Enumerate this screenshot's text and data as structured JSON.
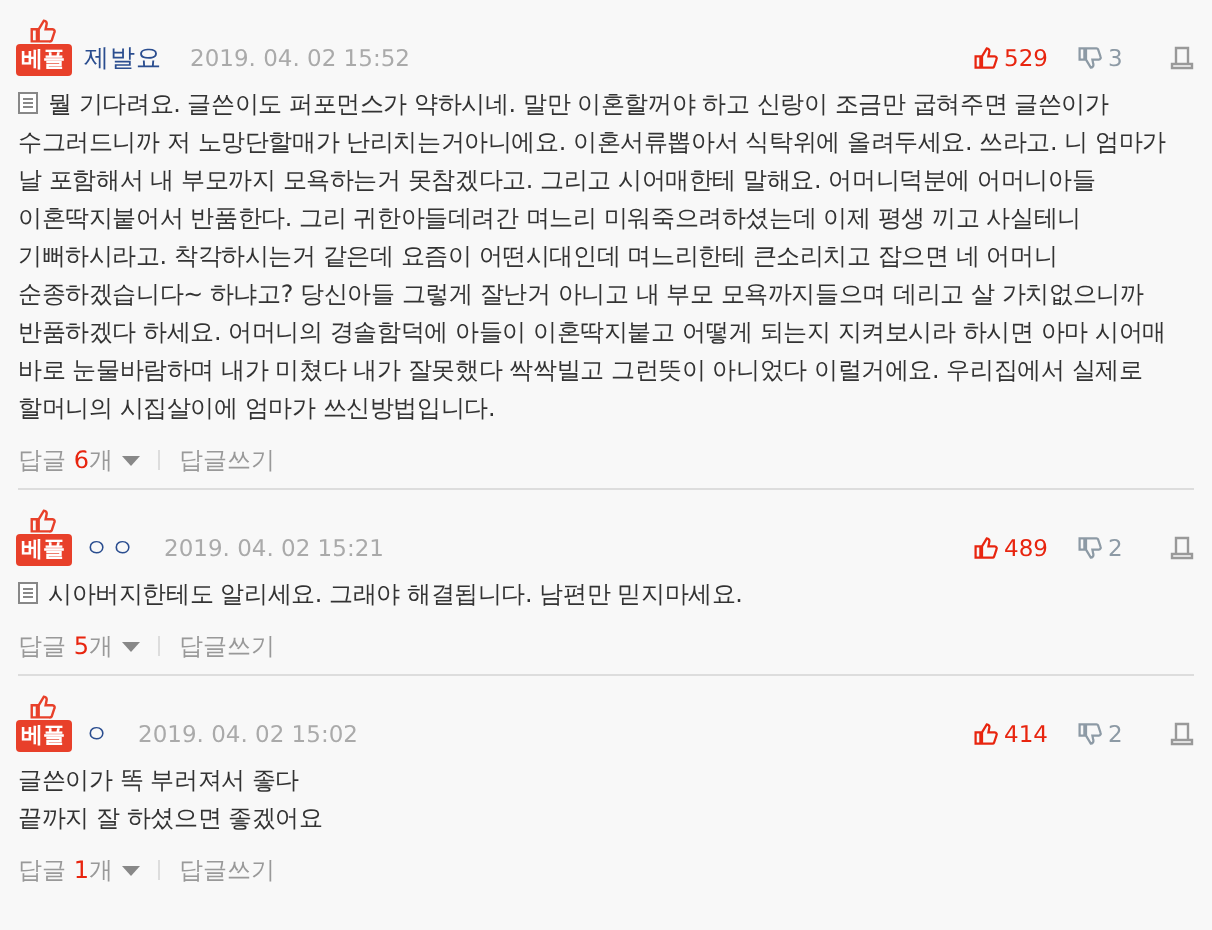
{
  "comments": [
    {
      "badge": "베플",
      "author": "제발요",
      "date": "2019. 04. 02 15:52",
      "likes": "529",
      "dislikes": "3",
      "memo": true,
      "text": "뭘 기다려요. 글쓴이도 퍼포먼스가 약하시네. 말만 이혼할꺼야 하고 신랑이 조금만 굽혀주면 글쓴이가 수그러드니까 저 노망단할매가 난리치는거아니에요. 이혼서류뽑아서 식탁위에 올려두세요. 쓰라고. 니 엄마가 날 포함해서 내 부모까지 모욕하는거 못참겠다고. 그리고 시어매한테 말해요. 어머니덕분에 어머니아들 이혼딱지붙어서 반품한다. 그리 귀한아들데려간 며느리 미워죽으려하셨는데 이제 평생 끼고 사실테니 기뻐하시라고. 착각하시는거 같은데 요즘이 어떤시대인데 며느리한테 큰소리치고 잡으면 네 어머니 순종하겠습니다~ 하냐고? 당신아들 그렇게 잘난거 아니고 내 부모 모욕까지들으며 데리고 살 가치없으니까 반품하겠다 하세요. 어머니의 경솔함덕에 아들이 이혼딱지붙고 어떻게 되는지 지켜보시라 하시면 아마 시어매 바로 눈물바람하며 내가 미쳤다 내가 잘못했다 싹싹빌고 그런뜻이 아니었다 이럴거에요. 우리집에서 실제로 할머니의 시집살이에 엄마가 쓰신방법입니다.",
      "reply_label": "답글",
      "reply_count": "6",
      "reply_unit": "개",
      "write_label": "답글쓰기"
    },
    {
      "badge": "베플",
      "author": "ㅇㅇ",
      "date": "2019. 04. 02 15:21",
      "likes": "489",
      "dislikes": "2",
      "memo": true,
      "text": "시아버지한테도 알리세요. 그래야 해결됩니다. 남편만 믿지마세요.",
      "reply_label": "답글",
      "reply_count": "5",
      "reply_unit": "개",
      "write_label": "답글쓰기"
    },
    {
      "badge": "베플",
      "author": "ㅇ",
      "date": "2019. 04. 02 15:02",
      "likes": "414",
      "dislikes": "2",
      "memo": false,
      "text": "글쓴이가 똑 부러져서 좋다\n끝까지 잘 하셨으면 좋겠어요",
      "reply_label": "답글",
      "reply_count": "1",
      "reply_unit": "개",
      "write_label": "답글쓰기"
    }
  ]
}
